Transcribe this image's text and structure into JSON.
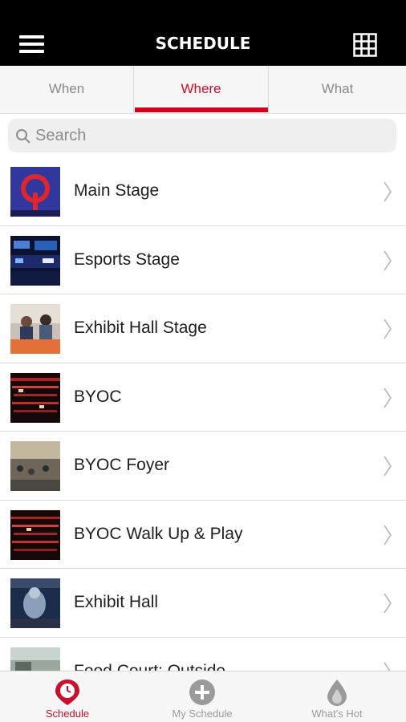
{
  "header": {
    "title": "SCHEDULE",
    "menu_icon": "hamburger-menu-icon",
    "grid_icon": "grid-view-icon"
  },
  "tabs": [
    {
      "label": "When",
      "active": false
    },
    {
      "label": "Where",
      "active": true
    },
    {
      "label": "What",
      "active": false
    }
  ],
  "colors": {
    "accent": "#d0021b",
    "header_bg": "#000000",
    "tab_bg": "#f6f6f6",
    "inactive_text": "#8a8a8a"
  },
  "search": {
    "placeholder": "Search",
    "value": ""
  },
  "locations": [
    {
      "label": "Main Stage"
    },
    {
      "label": "Esports Stage"
    },
    {
      "label": "Exhibit Hall Stage"
    },
    {
      "label": "BYOC"
    },
    {
      "label": "BYOC Foyer"
    },
    {
      "label": "BYOC Walk Up & Play"
    },
    {
      "label": "Exhibit Hall"
    },
    {
      "label": "Food Court: Outside"
    }
  ],
  "bottom_nav": [
    {
      "label": "Schedule",
      "icon": "clock-pin-icon",
      "active": true
    },
    {
      "label": "My Schedule",
      "icon": "plus-circle-icon",
      "active": false
    },
    {
      "label": "What's Hot",
      "icon": "flame-drop-icon",
      "active": false
    }
  ]
}
